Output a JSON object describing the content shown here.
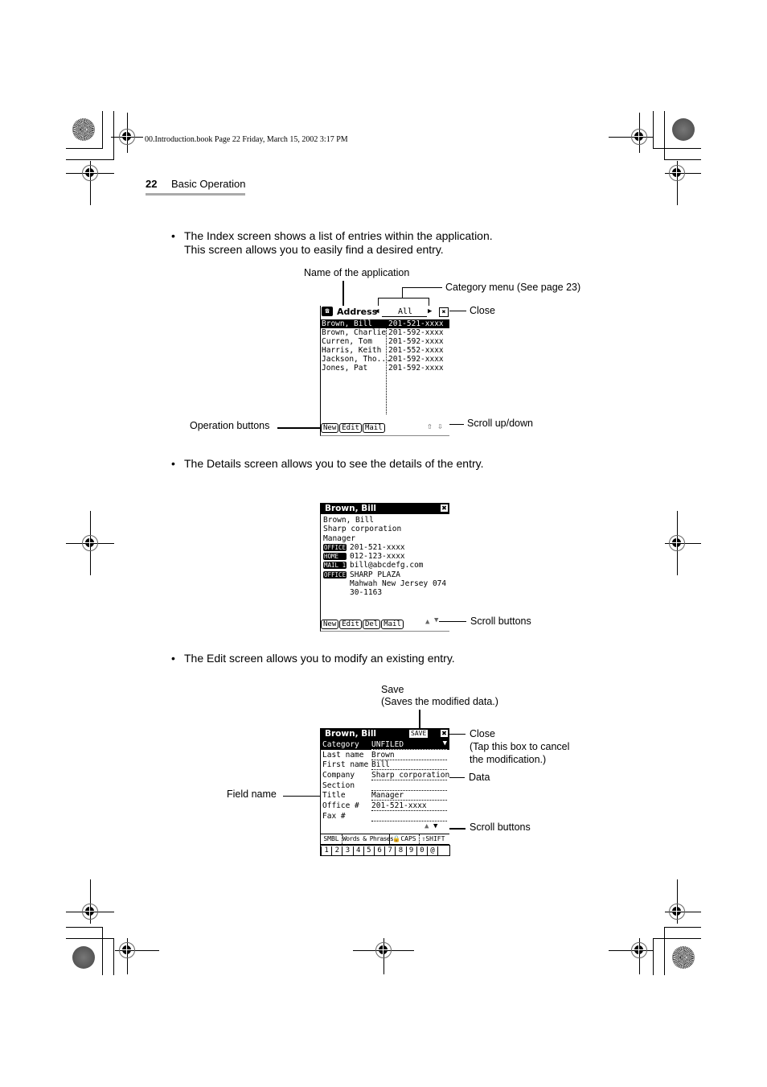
{
  "print_header": "00.Introduction.book  Page 22  Friday, March 15, 2002  3:17 PM",
  "page": {
    "number": "22",
    "section": "Basic Operation"
  },
  "bullets": [
    {
      "line1": "The Index screen shows a list of entries within the application.",
      "line2": "This screen allows you to easily find a desired entry."
    },
    {
      "line1": "The Details screen allows you to see the details of the entry."
    },
    {
      "line1": "The Edit screen allows you to modify an existing entry."
    }
  ],
  "bullet_glyph": "•",
  "index_screen": {
    "app_name": "Address",
    "category": "All",
    "close_glyph": "✖",
    "entries": [
      {
        "name": "Brown, Bill",
        "phone": "201-521-xxxx",
        "selected": true
      },
      {
        "name": "Brown, Charlie",
        "phone": "201-592-xxxx"
      },
      {
        "name": "Curren, Tom",
        "phone": "201-592-xxxx"
      },
      {
        "name": "Harris, Keith",
        "phone": "201-552-xxxx"
      },
      {
        "name": "Jackson, Tho...",
        "phone": "201-592-xxxx"
      },
      {
        "name": "Jones, Pat",
        "phone": "201-592-xxxx"
      }
    ],
    "buttons": [
      "New",
      "Edit",
      "Mail"
    ],
    "callouts": {
      "app_name": "Name of the application",
      "category": "Category menu (See page 23)",
      "close": "Close",
      "operation": "Operation buttons",
      "scroll": "Scroll up/down"
    }
  },
  "details_screen": {
    "title": "Brown, Bill",
    "lines": [
      "Brown, Bill",
      "Sharp corporation",
      "Manager"
    ],
    "tagged": [
      {
        "tag": "OFFICE",
        "value": "201-521-xxxx"
      },
      {
        "tag": "HOME",
        "value": "012-123-xxxx"
      },
      {
        "tag": "MAIL 1",
        "value": "bill@abcdefg.com"
      },
      {
        "tag": "OFFICE",
        "value": "SHARP PLAZA"
      }
    ],
    "address_cont": [
      "Mahwah New Jersey 074",
      "30-1163"
    ],
    "buttons": [
      "New",
      "Edit",
      "Del",
      "Mail"
    ],
    "callouts": {
      "scroll": "Scroll buttons"
    }
  },
  "edit_screen": {
    "title": "Brown, Bill",
    "save_label": "SAVE",
    "fields": [
      {
        "label": "Category",
        "value": "UNFILED",
        "selected": true
      },
      {
        "label": "Last name",
        "value": "Brown"
      },
      {
        "label": "First name",
        "value": "Bill"
      },
      {
        "label": "Company",
        "value": "Sharp corporation"
      },
      {
        "label": "Section",
        "value": ""
      },
      {
        "label": "Title",
        "value": "Manager"
      },
      {
        "label": "Office #",
        "value": "201-521-xxxx"
      },
      {
        "label": "Fax #",
        "value": ""
      }
    ],
    "keyboard_tabs": [
      "SMBL",
      "Words & Phrases",
      "CAPS",
      "SHIFT"
    ],
    "keys": [
      "1",
      "2",
      "3",
      "4",
      "5",
      "6",
      "7",
      "8",
      "9",
      "0",
      "@"
    ],
    "callouts": {
      "save": "Save",
      "save_desc": "(Saves the modified data.)",
      "close": "Close",
      "close_desc1": "(Tap this box to cancel",
      "close_desc2": "the modification.)",
      "data": "Data",
      "field_name": "Field name",
      "scroll": "Scroll buttons"
    }
  }
}
